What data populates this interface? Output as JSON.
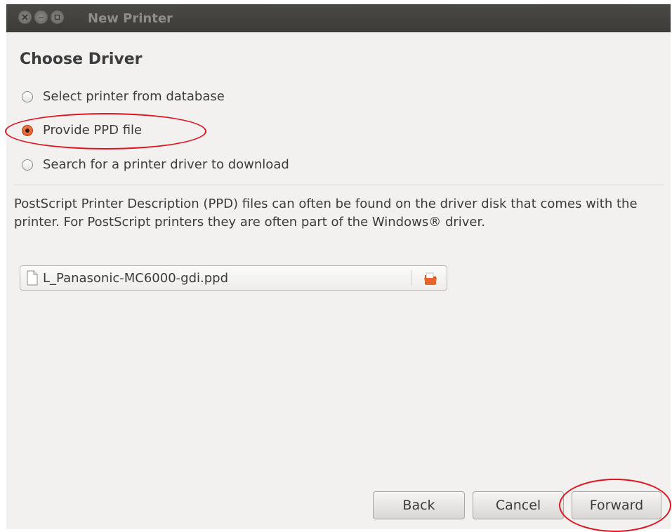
{
  "window": {
    "title": "New Printer"
  },
  "page": {
    "heading": "Choose Driver"
  },
  "options": [
    {
      "label": "Select printer from database",
      "checked": false
    },
    {
      "label": "Provide PPD file",
      "checked": true
    },
    {
      "label": "Search for a printer driver to download",
      "checked": false
    }
  ],
  "description": "PostScript Printer Description (PPD) files can often be found on the driver disk that comes with the printer. For PostScript printers they are often part of the Windows® driver.",
  "file_chooser": {
    "value": "L_Panasonic-MC6000-gdi.ppd",
    "file_icon": "document-icon",
    "button_icon": "folder-open-icon"
  },
  "buttons": {
    "back": "Back",
    "cancel": "Cancel",
    "forward": "Forward"
  },
  "colors": {
    "accent": "#dd4814",
    "annotation": "#e0141e",
    "titlebar": "#3c3b37"
  }
}
